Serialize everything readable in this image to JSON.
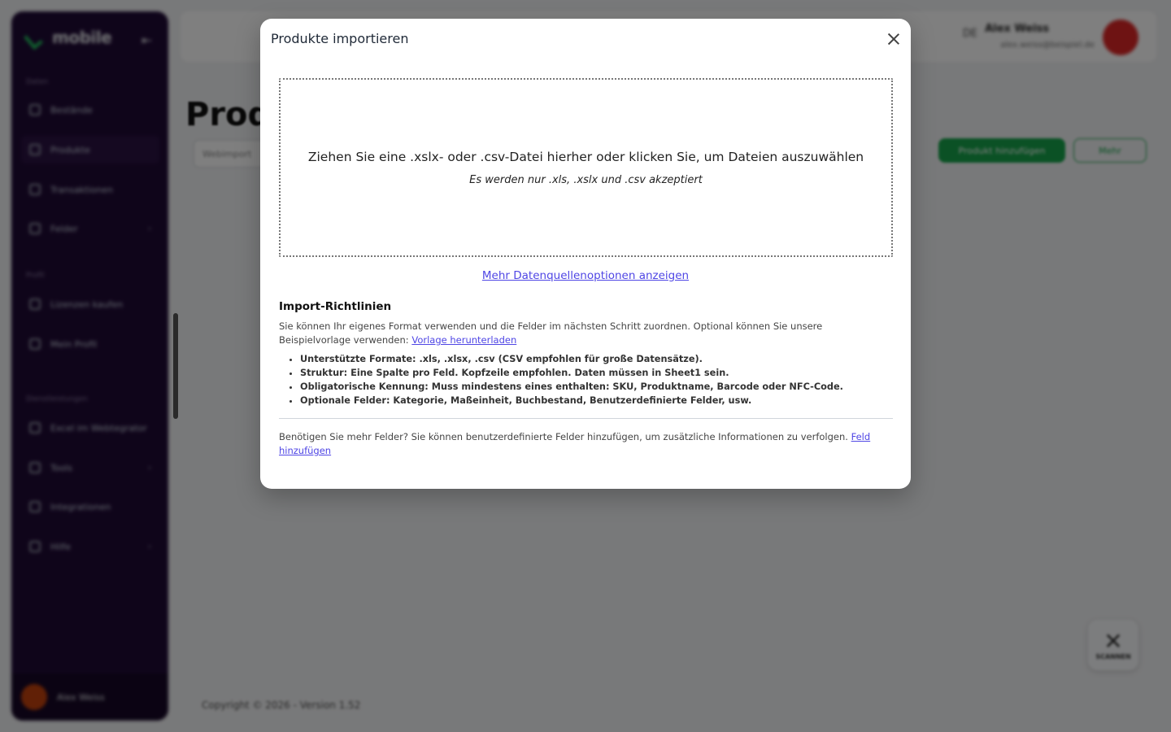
{
  "app": {
    "logo_text": "mobile",
    "page_title": "Prod",
    "search_placeholder": "Webimport",
    "add_button": "Produkt hinzufügen",
    "more_button": "Mehr",
    "language": "DE",
    "user_name": "Alex Weiss",
    "user_email": "alex.weiss@beispiel.de",
    "copyright": "Copyright © 2026 - Version 1.52",
    "scanner_label": "SCANNEN",
    "sidebar": {
      "sections": [
        "Daten",
        "Profil",
        "Dienstleistungen"
      ],
      "items": [
        {
          "label": "Bestände"
        },
        {
          "label": "Produkte"
        },
        {
          "label": "Transaktionen"
        },
        {
          "label": "Felder"
        },
        {
          "label": "Lizenzen kaufen"
        },
        {
          "label": "Mein Profil"
        },
        {
          "label": "Excel im Webtegrator"
        },
        {
          "label": "Tools"
        },
        {
          "label": "Integrationen"
        },
        {
          "label": "Hilfe"
        }
      ],
      "footer_name": "Alex Weiss"
    }
  },
  "modal": {
    "title": "Produkte importieren",
    "dropzone_main": "Ziehen Sie eine .xslx- oder .csv-Datei hierher oder klicken Sie, um Dateien auszuwählen",
    "dropzone_sub": "Es werden nur .xls, .xslx und .csv akzeptiert",
    "more_sources_link": "Mehr Datenquellenoptionen anzeigen",
    "guidelines_title": "Import-Richtlinien",
    "guidelines_text": "Sie können Ihr eigenes Format verwenden und die Felder im nächsten Schritt zuordnen. Optional können Sie unsere Beispielvorlage verwenden:",
    "template_link": "Vorlage herunterladen",
    "bullets": [
      "Unterstützte Formate: .xls, .xlsx, .csv (CSV empfohlen für große Datensätze).",
      "Struktur: Eine Spalte pro Feld. Kopfzeile empfohlen. Daten müssen in Sheet1 sein.",
      "Obligatorische Kennung: Muss mindestens eines enthalten: SKU, Produktname, Barcode oder NFC-Code.",
      "Optionale Felder: Kategorie, Maßeinheit, Buchbestand, Benutzerdefinierte Felder, usw."
    ],
    "fields_text": "Benötigen Sie mehr Felder? Sie können benutzerdefinierte Felder hinzufügen, um zusätzliche Informationen zu verfolgen.",
    "add_field_link": "Feld hinzufügen"
  }
}
